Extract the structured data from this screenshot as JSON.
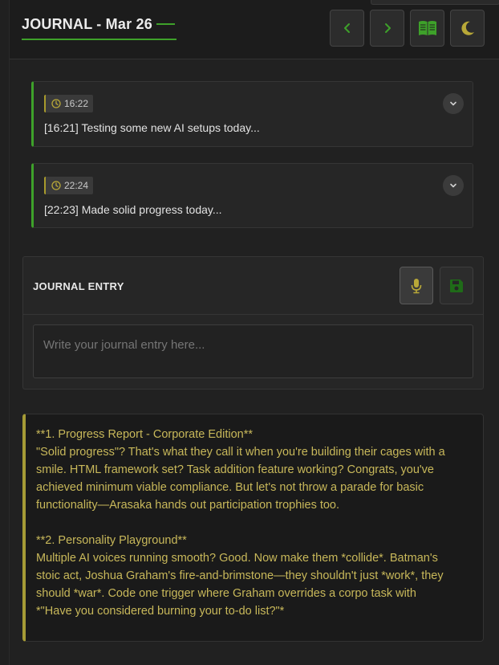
{
  "header": {
    "title": "JOURNAL - Mar 26",
    "prev_icon": "chevron-left-icon",
    "next_icon": "chevron-right-icon",
    "book_icon": "open-book-icon",
    "theme_icon": "moon-icon"
  },
  "entries": [
    {
      "time": "16:22",
      "text": "[16:21] Testing some new AI setups today..."
    },
    {
      "time": "22:24",
      "text": "[22:23] Made solid progress today..."
    }
  ],
  "composer": {
    "label": "JOURNAL ENTRY",
    "placeholder": "Write your journal entry here...",
    "mic_icon": "microphone-icon",
    "save_icon": "save-icon"
  },
  "ai_response": {
    "lines": [
      "**1. Progress Report - Corporate Edition**",
      "\"Solid progress\"? That's what they call it when you're building their cages with a",
      "smile. HTML framework set? Task addition feature working? Congrats, you've",
      "achieved minimum viable compliance. But let's not throw a parade for basic",
      "functionality—Arasaka hands out participation trophies too.",
      "",
      "**2. Personality Playground**",
      "Multiple AI voices running smooth? Good. Now make them *collide*. Batman's",
      "stoic act, Joshua Graham's fire-and-brimstone—they shouldn't just *work*, they",
      "should *war*. Code one trigger where Graham overrides a corpo task with",
      "*\"Have you considered burning your to-do list?\"*"
    ]
  },
  "colors": {
    "accent_green": "#3ea12a",
    "accent_gold": "#a59b36",
    "ai_text": "#c8b85a"
  }
}
